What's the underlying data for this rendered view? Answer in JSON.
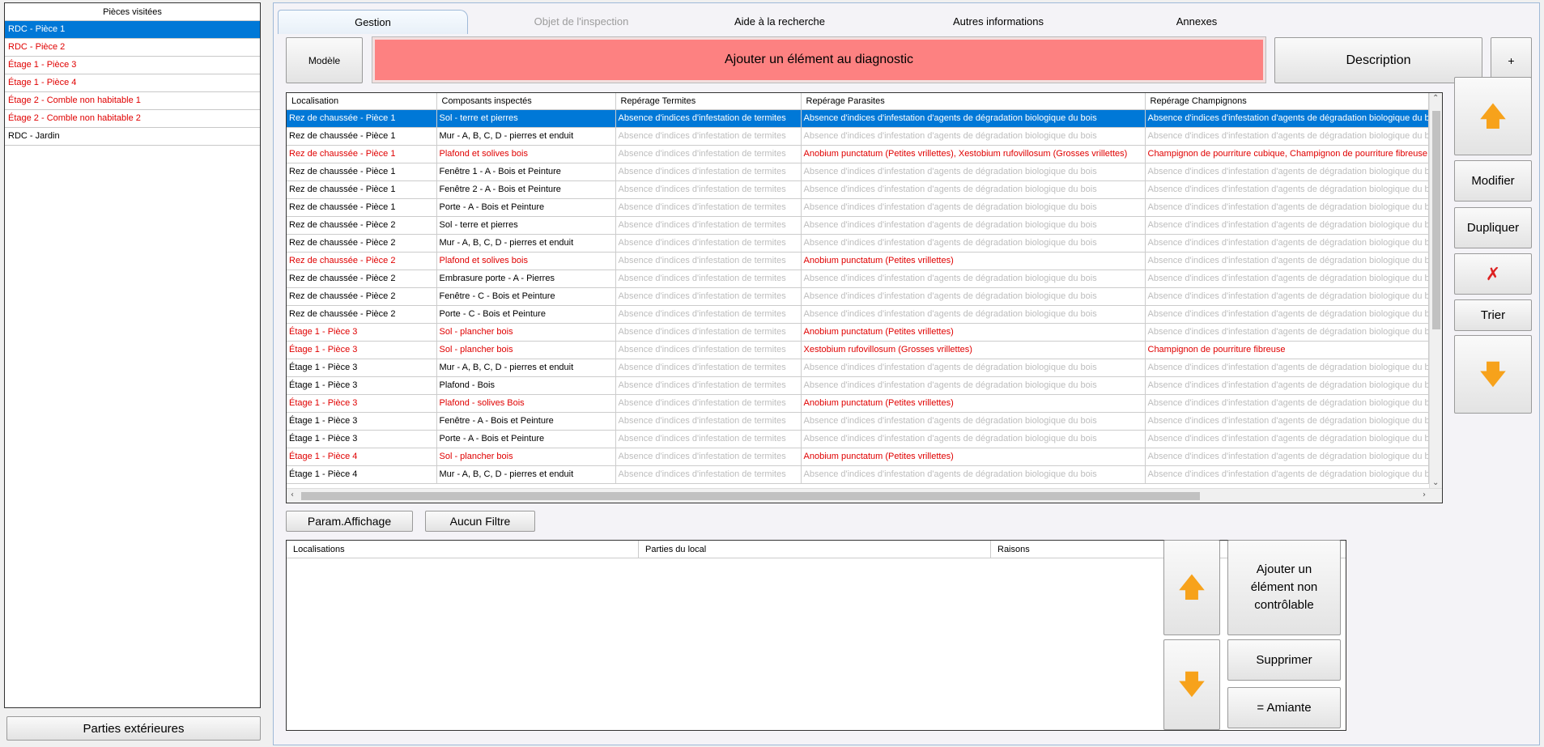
{
  "left": {
    "header": "Pièces visitées",
    "rooms": [
      {
        "label": "RDC - Pièce 1",
        "style": "selected"
      },
      {
        "label": "RDC - Pièce 2",
        "style": "red"
      },
      {
        "label": "Étage  1 - Pièce  3",
        "style": "red"
      },
      {
        "label": "Étage  1 - Pièce  4",
        "style": "red"
      },
      {
        "label": "Étage  2 - Comble non habitable  1",
        "style": "red"
      },
      {
        "label": "Étage  2 - Comble non habitable  2",
        "style": "red"
      },
      {
        "label": "RDC - Jardin",
        "style": "normal"
      }
    ],
    "ext_button": "Parties extérieures"
  },
  "tabs": [
    "Gestion",
    "Objet de l'inspection",
    "Aide à la recherche",
    "Autres informations",
    "Annexes"
  ],
  "toolbar": {
    "model_label": "Modèle",
    "add_label": "Ajouter un élément au diagnostic",
    "description_label": "Description",
    "plus_label": "+"
  },
  "grid": {
    "columns": [
      "Localisation",
      "Composants inspectés",
      "Repérage Termites",
      "Repérage Parasites",
      "Repérage Champignons"
    ],
    "rows": [
      {
        "s": "sel",
        "c": [
          "Rez de chaussée - Pièce 1",
          "Sol - terre et pierres",
          "Absence d'indices d'infestation de termites",
          "Absence d'indices d'infestation d'agents de dégradation biologique du bois",
          "Absence d'indices d'infestation d'agents de dégradation biologique du bois"
        ]
      },
      {
        "s": "n",
        "c": [
          "Rez de chaussée - Pièce 1",
          "Mur - A, B, C, D - pierres et enduit",
          "Absence d'indices d'infestation de termites",
          "Absence d'indices d'infestation d'agents de dégradation biologique du bois",
          "Absence d'indices d'infestation d'agents de dégradation biologique du bois"
        ]
      },
      {
        "s": "r",
        "c": [
          "Rez de chaussée - Pièce 1",
          "Plafond et solives bois",
          "Absence d'indices d'infestation de termites",
          "Anobium punctatum (Petites vrillettes), Xestobium rufovillosum (Grosses vrillettes)",
          "Champignon de pourriture cubique, Champignon de pourriture fibreuse"
        ]
      },
      {
        "s": "n",
        "c": [
          "Rez de chaussée - Pièce 1",
          "Fenêtre 1 - A - Bois et Peinture",
          "Absence d'indices d'infestation de termites",
          "Absence d'indices d'infestation d'agents de dégradation biologique du bois",
          "Absence d'indices d'infestation d'agents de dégradation biologique du bois"
        ]
      },
      {
        "s": "n",
        "c": [
          "Rez de chaussée - Pièce 1",
          "Fenêtre 2 - A - Bois et Peinture",
          "Absence d'indices d'infestation de termites",
          "Absence d'indices d'infestation d'agents de dégradation biologique du bois",
          "Absence d'indices d'infestation d'agents de dégradation biologique du bois"
        ]
      },
      {
        "s": "n",
        "c": [
          "Rez de chaussée - Pièce 1",
          "Porte - A - Bois et Peinture",
          "Absence d'indices d'infestation de termites",
          "Absence d'indices d'infestation d'agents de dégradation biologique du bois",
          "Absence d'indices d'infestation d'agents de dégradation biologique du bois"
        ]
      },
      {
        "s": "n",
        "c": [
          "Rez de chaussée - Pièce 2",
          "Sol - terre et pierres",
          "Absence d'indices d'infestation de termites",
          "Absence d'indices d'infestation d'agents de dégradation biologique du bois",
          "Absence d'indices d'infestation d'agents de dégradation biologique du bois"
        ]
      },
      {
        "s": "n",
        "c": [
          "Rez de chaussée - Pièce 2",
          "Mur - A, B, C, D - pierres et enduit",
          "Absence d'indices d'infestation de termites",
          "Absence d'indices d'infestation d'agents de dégradation biologique du bois",
          "Absence d'indices d'infestation d'agents de dégradation biologique du bois"
        ]
      },
      {
        "s": "r",
        "c": [
          "Rez de chaussée - Pièce 2",
          "Plafond et solives bois",
          "Absence d'indices d'infestation de termites",
          "Anobium punctatum (Petites vrillettes)",
          "Absence d'indices d'infestation d'agents de dégradation biologique du bois"
        ]
      },
      {
        "s": "n",
        "c": [
          "Rez de chaussée - Pièce 2",
          "Embrasure porte - A - Pierres",
          "Absence d'indices d'infestation de termites",
          "Absence d'indices d'infestation d'agents de dégradation biologique du bois",
          "Absence d'indices d'infestation d'agents de dégradation biologique du bois"
        ]
      },
      {
        "s": "n",
        "c": [
          "Rez de chaussée - Pièce 2",
          "Fenêtre - C - Bois et Peinture",
          "Absence d'indices d'infestation de termites",
          "Absence d'indices d'infestation d'agents de dégradation biologique du bois",
          "Absence d'indices d'infestation d'agents de dégradation biologique du bois"
        ]
      },
      {
        "s": "n",
        "c": [
          "Rez de chaussée - Pièce 2",
          "Porte - C - Bois et Peinture",
          "Absence d'indices d'infestation de termites",
          "Absence d'indices d'infestation d'agents de dégradation biologique du bois",
          "Absence d'indices d'infestation d'agents de dégradation biologique du bois"
        ]
      },
      {
        "s": "r",
        "c": [
          "Étage  1 - Pièce  3",
          "Sol - plancher bois",
          "Absence d'indices d'infestation de termites",
          "Anobium punctatum (Petites vrillettes)",
          "Absence d'indices d'infestation d'agents de dégradation biologique du bois"
        ]
      },
      {
        "s": "r",
        "c": [
          "Étage  1 - Pièce  3",
          "Sol - plancher bois",
          "Absence d'indices d'infestation de termites",
          "Xestobium rufovillosum (Grosses vrillettes)",
          "Champignon de pourriture fibreuse"
        ]
      },
      {
        "s": "n",
        "c": [
          "Étage  1 - Pièce  3",
          "Mur - A, B, C, D - pierres et enduit",
          "Absence d'indices d'infestation de termites",
          "Absence d'indices d'infestation d'agents de dégradation biologique du bois",
          "Absence d'indices d'infestation d'agents de dégradation biologique du bois"
        ]
      },
      {
        "s": "n",
        "c": [
          "Étage  1 - Pièce  3",
          "Plafond - Bois",
          "Absence d'indices d'infestation de termites",
          "Absence d'indices d'infestation d'agents de dégradation biologique du bois",
          "Absence d'indices d'infestation d'agents de dégradation biologique du bois"
        ]
      },
      {
        "s": "r",
        "c": [
          "Étage  1 - Pièce  3",
          "Plafond - solives Bois",
          "Absence d'indices d'infestation de termites",
          "Anobium punctatum (Petites vrillettes)",
          "Absence d'indices d'infestation d'agents de dégradation biologique du bois"
        ]
      },
      {
        "s": "n",
        "c": [
          "Étage  1 - Pièce  3",
          "Fenêtre - A - Bois et Peinture",
          "Absence d'indices d'infestation de termites",
          "Absence d'indices d'infestation d'agents de dégradation biologique du bois",
          "Absence d'indices d'infestation d'agents de dégradation biologique du bois"
        ]
      },
      {
        "s": "n",
        "c": [
          "Étage  1 - Pièce  3",
          "Porte - A - Bois et Peinture",
          "Absence d'indices d'infestation de termites",
          "Absence d'indices d'infestation d'agents de dégradation biologique du bois",
          "Absence d'indices d'infestation d'agents de dégradation biologique du bois"
        ]
      },
      {
        "s": "r",
        "c": [
          "Étage  1 - Pièce  4",
          "Sol - plancher bois",
          "Absence d'indices d'infestation de termites",
          "Anobium punctatum (Petites vrillettes)",
          "Absence d'indices d'infestation d'agents de dégradation biologique du bois"
        ]
      },
      {
        "s": "n",
        "c": [
          "Étage  1 - Pièce  4",
          "Mur - A, B, C, D - pierres et enduit",
          "Absence d'indices d'infestation de termites",
          "Absence d'indices d'infestation d'agents de dégradation biologique du bois",
          "Absence d'indices d'infestation d'agents de dégradation biologique du bois"
        ]
      }
    ]
  },
  "side_buttons": {
    "modify": "Modifier",
    "duplicate": "Dupliquer",
    "sort": "Trier"
  },
  "filters": {
    "display_params": "Param.Affichage",
    "no_filter": "Aucun Filtre"
  },
  "grid2": {
    "columns": [
      "Localisations",
      "Parties du local",
      "Raisons"
    ]
  },
  "bottom_buttons": {
    "add_uncontrollable": "Ajouter un élément non contrôlable",
    "delete": "Supprimer",
    "asbestos": "= Amiante"
  },
  "colors": {
    "selection": "#0078d7",
    "alert_red": "#e00000",
    "add_button_bg": "#fd8181",
    "arrow_orange": "#f7a21b"
  }
}
